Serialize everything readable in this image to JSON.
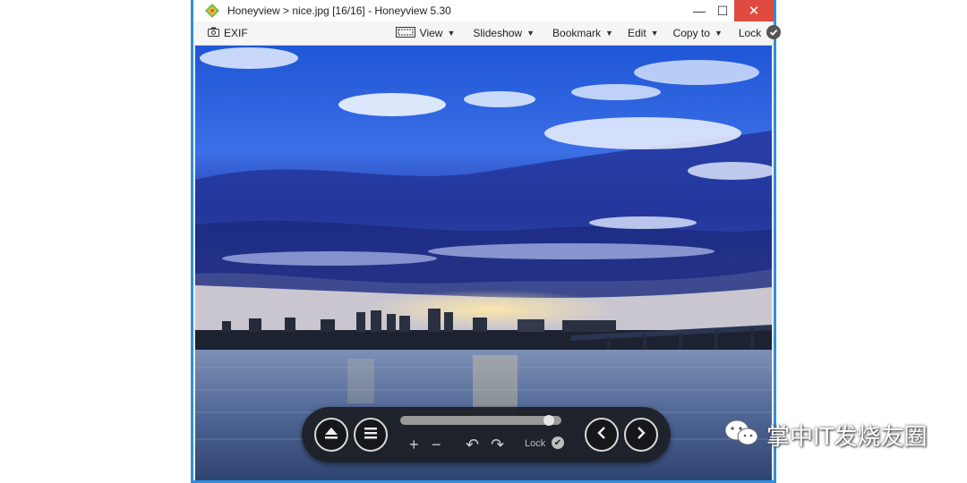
{
  "window": {
    "title": "Honeyview > nice.jpg [16/16] - Honeyview 5.30",
    "minimize_glyph": "—",
    "maximize_glyph": "☐",
    "close_glyph": "✕",
    "frame_color": "#2e8fe0"
  },
  "toolbar": {
    "exif_label": "EXIF",
    "view_label": "View",
    "slideshow_label": "Slideshow",
    "bookmark_label": "Bookmark",
    "edit_label": "Edit",
    "copy_to_label": "Copy to",
    "lock_label": "Lock"
  },
  "controls": {
    "eject_icon": "eject-icon",
    "menu_icon": "menu-icon",
    "zoom_in": "+",
    "zoom_out": "−",
    "rotate_left": "↶",
    "rotate_right": "↷",
    "lock_label": "Lock",
    "prev_icon": "chevron-left-icon",
    "next_icon": "chevron-right-icon",
    "slider_position": 0.95
  },
  "watermark": {
    "text": "掌中IT发烧友圈"
  }
}
